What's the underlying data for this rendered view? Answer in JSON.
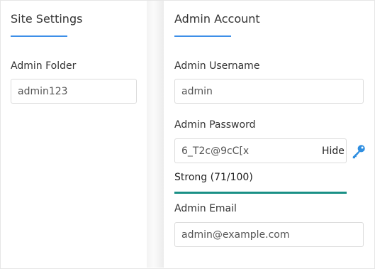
{
  "site_settings": {
    "title": "Site Settings",
    "admin_folder_label": "Admin Folder",
    "admin_folder_value": "admin123"
  },
  "admin_account": {
    "title": "Admin Account",
    "username_label": "Admin Username",
    "username_value": "admin",
    "password_label": "Admin Password",
    "password_value": "6_T2c@9cC[x",
    "password_toggle_label": "Hide",
    "password_key_icon": "key-icon",
    "strength_text": "Strong (71/100)",
    "strength_fraction": 1.0,
    "strength_color": "#1a9086",
    "email_label": "Admin Email",
    "email_value": "admin@example.com"
  },
  "colors": {
    "accent_underline": "#3d8fe8",
    "key_icon": "#2f8ee0"
  }
}
